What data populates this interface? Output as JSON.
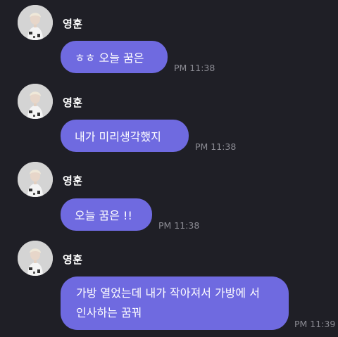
{
  "messages": [
    {
      "sender": "영훈",
      "text": "ㅎㅎ 오늘 꿈은",
      "time": "PM 11:38"
    },
    {
      "sender": "영훈",
      "text": "내가 미리생각했지",
      "time": "PM 11:38"
    },
    {
      "sender": "영훈",
      "text": "오늘 꿈은 !!",
      "time": "PM 11:38"
    },
    {
      "sender": "영훈",
      "text": "가방 열었는데 내가 작아져서 가방에 서 인사하는 꿈꿔",
      "time": "PM 11:39"
    }
  ],
  "colors": {
    "background": "#1f1f26",
    "bubble": "#6f6ae0",
    "bubble_text": "#ffffff",
    "sender_text": "#ffffff",
    "time_text": "#8b8b93"
  }
}
